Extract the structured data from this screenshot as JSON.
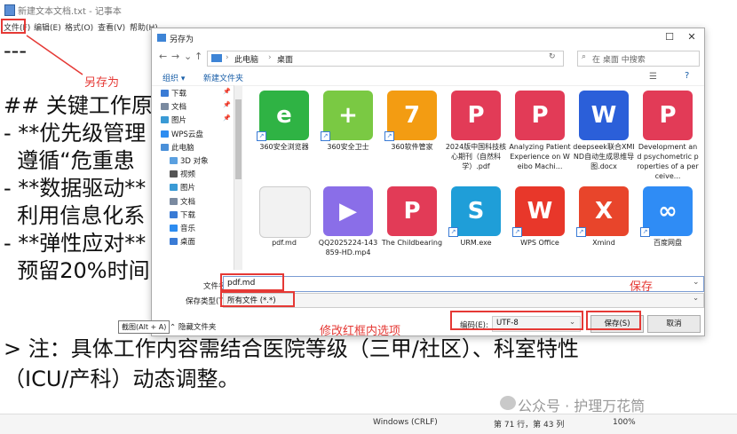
{
  "notepad": {
    "title": "新建文本文档.txt - 记事本",
    "menu": [
      "文件(F)",
      "编辑(E)",
      "格式(O)",
      "查看(V)",
      "帮助(H)"
    ],
    "lines": [
      "---",
      "",
      "## 关键工作原",
      "- **优先级管理",
      "  遵循“危重患",
      "- **数据驱动**",
      "  利用信息化系",
      "- **弹性应对**",
      "  预留20%时间",
      "",
      "> 注：具体工作内容需结合医院等级（三甲/社区）、科室特性",
      "（ICU/产科）动态调整。"
    ],
    "status": {
      "line_ending": "Windows (CRLF)",
      "position": "第 71 行，第 43 列",
      "zoom": "100%"
    }
  },
  "dialog": {
    "title": "另存为",
    "window_buttons": {
      "close": "✕",
      "maximize": "☐"
    },
    "breadcrumb": [
      "此电脑",
      "桌面"
    ],
    "search_placeholder": "在 桌面 中搜索",
    "toolbar": {
      "organize": "组织 ▾",
      "new_folder": "新建文件夹"
    },
    "sidebar": [
      {
        "label": "下载",
        "pinned": true,
        "color": "#3a7bd5"
      },
      {
        "label": "文档",
        "pinned": true,
        "color": "#7a8aa0"
      },
      {
        "label": "图片",
        "pinned": true,
        "color": "#3a9ad5"
      },
      {
        "label": "WPS云盘",
        "pinned": false,
        "color": "#2d8cf0"
      },
      {
        "label": "此电脑",
        "pinned": false,
        "color": "#4a90d9"
      },
      {
        "label": "3D 对象",
        "pinned": false,
        "color": "#5aa0e0"
      },
      {
        "label": "视频",
        "pinned": false,
        "color": "#555555"
      },
      {
        "label": "图片",
        "pinned": false,
        "color": "#3a9ad5"
      },
      {
        "label": "文档",
        "pinned": false,
        "color": "#7a8aa0"
      },
      {
        "label": "下载",
        "pinned": false,
        "color": "#3a7bd5"
      },
      {
        "label": "音乐",
        "pinned": false,
        "color": "#2d8cf0"
      },
      {
        "label": "桌面",
        "pinned": false,
        "color": "#3a7bd5"
      }
    ],
    "files": [
      {
        "name": "360安全浏览器",
        "icon": "360-browser-icon",
        "color": "#2fb344",
        "glyph": "e",
        "shortcut": true
      },
      {
        "name": "360安全卫士",
        "icon": "360-safe-icon",
        "color": "#7ac943",
        "glyph": "+",
        "shortcut": true
      },
      {
        "name": "360软件管家",
        "icon": "360-software-icon",
        "color": "#f39c12",
        "glyph": "7",
        "shortcut": true
      },
      {
        "name": "2024版中国科技核心期刊（自然科学）.pdf",
        "icon": "pdf-icon",
        "color": "#e23b57",
        "glyph": "P",
        "shortcut": false
      },
      {
        "name": "Analyzing Patient Experience on Weibo Machi...",
        "icon": "pdf-icon",
        "color": "#e23b57",
        "glyph": "P",
        "shortcut": false
      },
      {
        "name": "deepseek联合XMIND自动生成思维导图.docx",
        "icon": "word-icon",
        "color": "#2b5fd9",
        "glyph": "W",
        "shortcut": false
      },
      {
        "name": "Development and psychometric properties of a perceive...",
        "icon": "pdf-icon",
        "color": "#e23b57",
        "glyph": "P",
        "shortcut": false
      },
      {
        "name": "pdf.md",
        "icon": "md-file-icon",
        "color": "#f2f2f2",
        "glyph": "",
        "shortcut": false
      },
      {
        "name": "QQ2025224-143859-HD.mp4",
        "icon": "video-icon",
        "color": "#8a6ee8",
        "glyph": "▶",
        "shortcut": false
      },
      {
        "name": "The Childbearing",
        "icon": "pdf-icon",
        "color": "#e23b57",
        "glyph": "P",
        "shortcut": false
      },
      {
        "name": "URM.exe",
        "icon": "urm-icon",
        "color": "#1f9ed8",
        "glyph": "S",
        "shortcut": true
      },
      {
        "name": "WPS Office",
        "icon": "wps-icon",
        "color": "#e8372a",
        "glyph": "W",
        "shortcut": true
      },
      {
        "name": "Xmind",
        "icon": "xmind-icon",
        "color": "#e8452b",
        "glyph": "X",
        "shortcut": true
      },
      {
        "name": "百度网盘",
        "icon": "baidu-netdisk-icon",
        "color": "#2f8cf5",
        "glyph": "∞",
        "shortcut": true
      }
    ],
    "filename_label": "文件名(N):",
    "filename_value": "pdf.md",
    "filetype_label": "保存类型(T):",
    "filetype_value": "所有文件  (*.*)",
    "hide_folders": "隐藏文件夹",
    "encoding_label": "编码(E):",
    "encoding_value": "UTF-8",
    "save_button": "保存(S)",
    "cancel_button": "取消"
  },
  "tooltip": "截图(Alt + A)",
  "annotations": {
    "save_as": "另存为",
    "modify": "修改红框内选项",
    "save": "保存"
  },
  "watermark": "公众号 · 护理万花筒",
  "colors": {
    "annotation_red": "#e53935",
    "link_blue": "#1a5fa8"
  }
}
